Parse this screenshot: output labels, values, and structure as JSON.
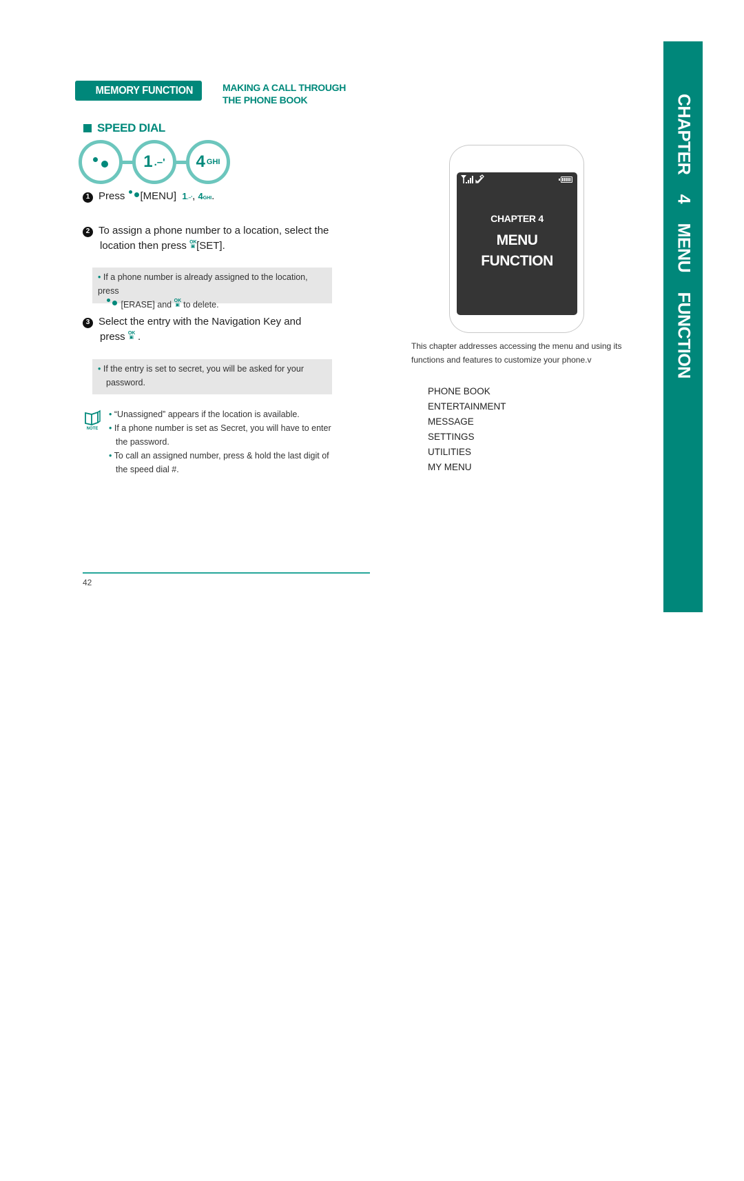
{
  "header": {
    "section_tab": "MEMORY FUNCTION",
    "section_subtitle_line1": "MAKING A CALL THROUGH",
    "section_subtitle_line2": "THE PHONE BOOK"
  },
  "speed_dial": {
    "title": "SPEED DIAL",
    "key_sequence": [
      {
        "icon": "menu-dots-icon"
      },
      {
        "big": "1",
        "small": ".–'"
      },
      {
        "big": "4",
        "small": "GHI"
      }
    ]
  },
  "steps": [
    {
      "number": "1",
      "text_press": "Press",
      "text_menu": "[MENU]",
      "key1_big": "1",
      "key1_small": ".–'",
      "separator": ",",
      "key2_big": "4",
      "key2_small": "GHI",
      "end": "."
    },
    {
      "number": "2",
      "line1": "To assign a phone number to a location, select the",
      "line2_pre": "location then press",
      "line2_post": "[SET].",
      "tip_line1": "If a phone number is already assigned to the location, press",
      "tip_line2_mid": "[ERASE] and",
      "tip_line2_end": "to delete."
    },
    {
      "number": "3",
      "line1": "Select the entry with the Navigation Key and",
      "line2_pre": "press",
      "line2_post": ".",
      "tip_line1": "If the entry is set to secret, you will be asked for your",
      "tip_line2": "password."
    }
  ],
  "note": {
    "label": "NOTE",
    "items": [
      "“Unassigned” appears if the location is available.",
      "If a phone number is set as Secret, you will have to enter the password.",
      "To call an assigned number, press & hold the last digit of the speed dial #."
    ]
  },
  "ok_key": {
    "top": "OK",
    "bottom": "▣"
  },
  "footer": {
    "page_number": "42"
  },
  "phone_screen": {
    "chapter": "CHAPTER 4",
    "title_line1": "MENU",
    "title_line2": "FUNCTION"
  },
  "intro": {
    "text": "This chapter addresses accessing the menu and using its functions and features to customize your phone.v"
  },
  "menu_list": [
    "PHONE BOOK",
    "ENTERTAINMENT",
    "MESSAGE",
    "SETTINGS",
    "UTILITIES",
    "MY MENU"
  ],
  "chapter_tab": {
    "text": "CHAPTER 4 MENU FUNCTION"
  },
  "colors": {
    "brand_teal": "#00877a",
    "light_teal": "#6cc6bd",
    "tip_gray": "#e6e6e6",
    "screen_dark": "#353535"
  }
}
